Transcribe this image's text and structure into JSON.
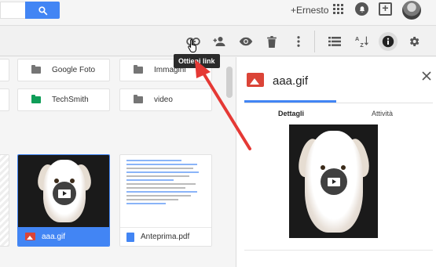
{
  "header": {
    "user_name": "+Ernesto"
  },
  "tooltip": {
    "text": "Ottieni link"
  },
  "folders": [
    {
      "name": "Google Foto",
      "color": "#757575"
    },
    {
      "name": "Immagini",
      "color": "#757575"
    },
    {
      "name": "TechSmith",
      "color": "#0f9d58"
    },
    {
      "name": "video",
      "color": "#757575"
    }
  ],
  "files": [
    {
      "name": "aaa.gif",
      "type": "image",
      "selected": true
    },
    {
      "name": "Anteprima.pdf",
      "type": "document",
      "selected": false
    }
  ],
  "details": {
    "title": "aaa.gif",
    "tabs": [
      "Dettagli",
      "Attività"
    ],
    "active_tab": "Dettagli"
  },
  "colors": {
    "accent": "#4285f4",
    "image_red": "#db4437",
    "arrow_red": "#e53935"
  }
}
